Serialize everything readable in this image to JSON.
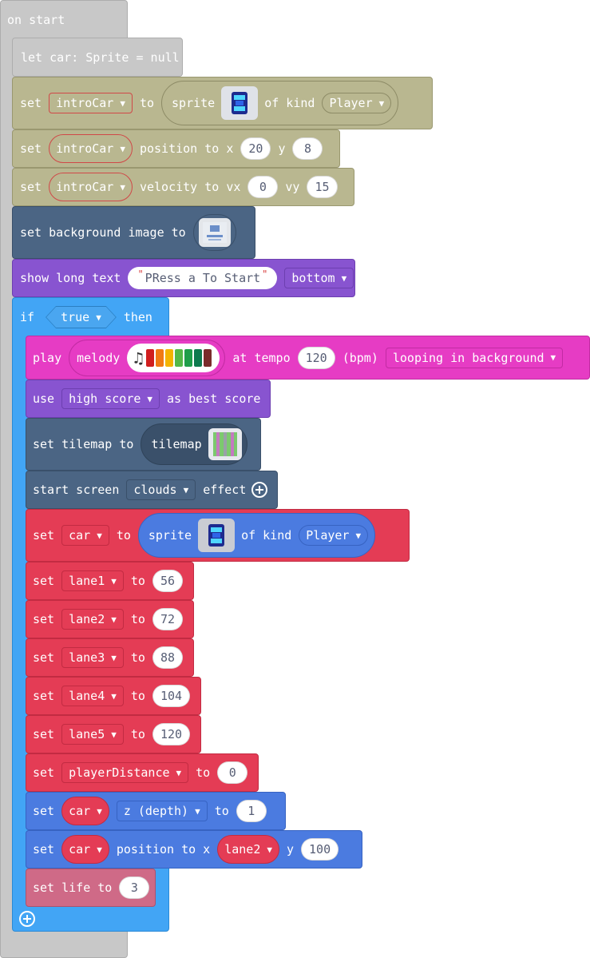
{
  "on_start": {
    "label": "on start"
  },
  "let_car": {
    "label": "let car: Sprite = null"
  },
  "intro_sprite": {
    "set": "set",
    "var": "introCar",
    "to": "to",
    "sprite": "sprite",
    "of_kind": "of kind",
    "kind": "Player"
  },
  "intro_position": {
    "set": "set",
    "var": "introCar",
    "label": "position to x",
    "x": "20",
    "y_label": "y",
    "y": "8"
  },
  "intro_velocity": {
    "set": "set",
    "var": "introCar",
    "label": "velocity to vx",
    "vx": "0",
    "vy_label": "vy",
    "vy": "15"
  },
  "background": {
    "label": "set background image to"
  },
  "long_text": {
    "label": "show long text",
    "text": "PRess a To Start",
    "position": "bottom"
  },
  "if_block": {
    "if": "if",
    "condition": "true",
    "then": "then"
  },
  "melody": {
    "play": "play",
    "melody": "melody",
    "at_tempo": "at tempo",
    "tempo": "120",
    "unit": "(bpm)",
    "mode": "looping in background",
    "colors": [
      "#d01e1e",
      "#f07a14",
      "#f4b400",
      "#54b848",
      "#1f9e4a",
      "#0d7a4e",
      "#7a2b2b"
    ]
  },
  "high_score": {
    "use": "use",
    "option": "high score",
    "suffix": "as best score"
  },
  "tilemap": {
    "label": "set tilemap to",
    "inner": "tilemap"
  },
  "screen_effect": {
    "label": "start screen",
    "effect": "clouds",
    "suffix": "effect"
  },
  "car_sprite": {
    "set": "set",
    "var": "car",
    "to": "to",
    "sprite": "sprite",
    "of_kind": "of kind",
    "kind": "Player"
  },
  "lanes": [
    {
      "set": "set",
      "var": "lane1",
      "to": "to",
      "value": "56"
    },
    {
      "set": "set",
      "var": "lane2",
      "to": "to",
      "value": "72"
    },
    {
      "set": "set",
      "var": "lane3",
      "to": "to",
      "value": "88"
    },
    {
      "set": "set",
      "var": "lane4",
      "to": "to",
      "value": "104"
    },
    {
      "set": "set",
      "var": "lane5",
      "to": "to",
      "value": "120"
    }
  ],
  "player_distance": {
    "set": "set",
    "var": "playerDistance",
    "to": "to",
    "value": "0"
  },
  "car_depth": {
    "set": "set",
    "var": "car",
    "prop": "z (depth)",
    "to": "to",
    "value": "1"
  },
  "car_position": {
    "set": "set",
    "var": "car",
    "label": "position to x",
    "x_var": "lane2",
    "y_label": "y",
    "y": "100"
  },
  "life": {
    "label": "set life to",
    "value": "3"
  },
  "colors": {
    "hat": "#c8c8c8",
    "intro": "#b9b790",
    "scene": "#4b6584",
    "text": "#8854d0",
    "logic": "#42a5f5",
    "music": "#e63cc4",
    "var": "#e43c55",
    "sprite": "#4b7be0",
    "info": "#cf6a87"
  }
}
